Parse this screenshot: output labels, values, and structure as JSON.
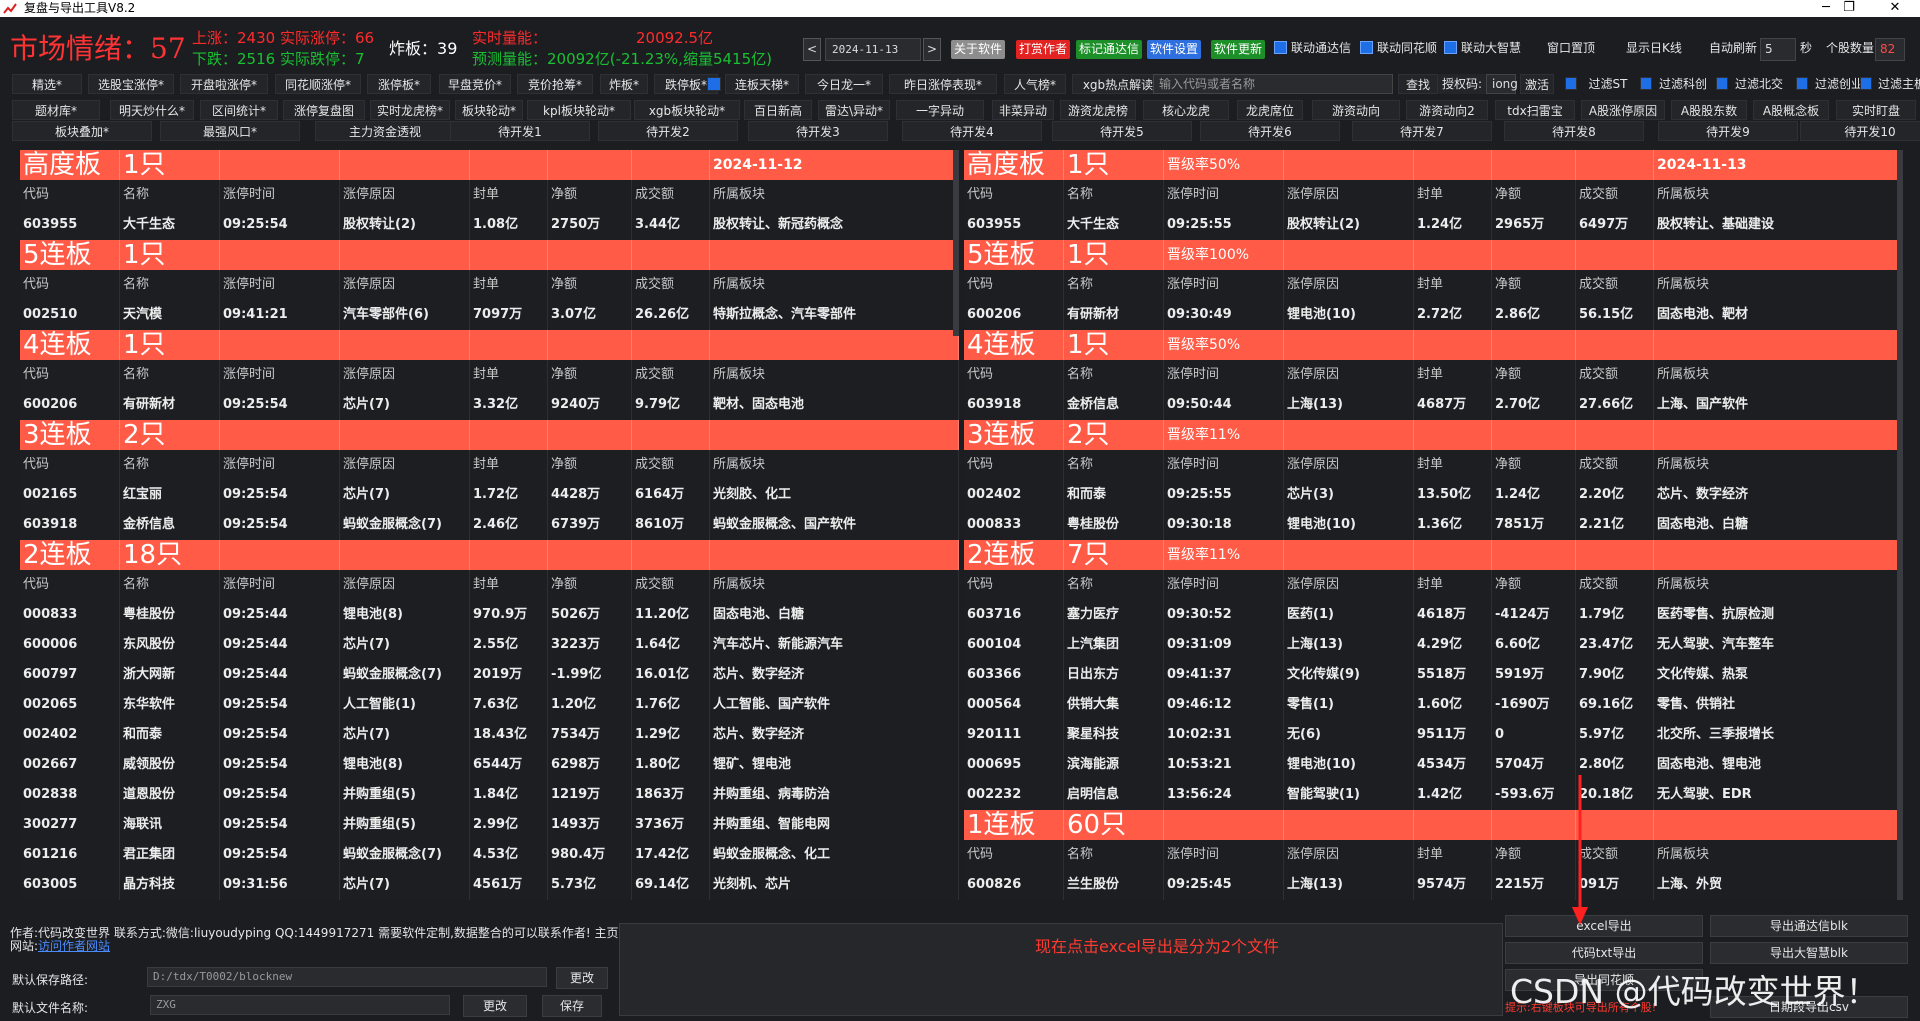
{
  "window": {
    "title": "复盘与导出工具V8.2",
    "min": "─",
    "max": "❐",
    "close": "✕"
  },
  "stats": {
    "mood_label": "市场情绪：",
    "mood_value": "57",
    "up": "上涨：2430 实际涨停：66",
    "down": "下跌：2516 实际跌停：7",
    "bomb_label": "炸板：",
    "bomb_value": "39",
    "realtime": "实时量能：",
    "realtime_value": "20092.5亿",
    "predict": "预测量能：20092亿(-21.23%,缩量5415亿)"
  },
  "controls": {
    "prev": "<",
    "date": "2024-11-13",
    "next": ">",
    "about": "关于软件",
    "tip": "打赏作者",
    "notes": "标记通达信",
    "settings": "软件设置",
    "update": "软件更新",
    "link_tdx": "联动通达信",
    "link_ths": "联动同花顺",
    "link_dzh": "联动大智慧",
    "pin": "窗口置顶",
    "show_k": "显示日K线",
    "auto_refresh": "自动刷新",
    "refresh_value": "5",
    "sec": "秒",
    "count_label": "个股数量",
    "count_value": "82"
  },
  "tabs_row1": [
    "精选*",
    "选股宝涨停*",
    "开盘啦涨停*",
    "同花顺涨停*",
    "涨停板*",
    "早盘竞价*",
    "竞价抢筹*",
    "炸板*",
    "跌停板*",
    "连板天梯*",
    "今日龙一*",
    "昨日涨停表现*",
    "人气榜*",
    "xgb热点解读*"
  ],
  "search": {
    "placeholder": "输入代码或者名称",
    "button": "查找",
    "auth_label": "授权码:",
    "auth_value": "iong",
    "activate": "激活"
  },
  "filters": [
    "过滤ST",
    "过滤科创",
    "过滤北交",
    "过滤创业",
    "过滤主板"
  ],
  "tabs_row2": [
    "题材库*",
    "明天炒什么*",
    "区间统计*",
    "涨停复盘图",
    "实时龙虎榜*",
    "板块轮动*",
    "kpl板块轮动*",
    "xgb板块轮动*",
    "百日新高",
    "雷达\\异动*",
    "一字异动",
    "非菜异动",
    "游资龙虎榜",
    "核心龙虎",
    "龙虎席位",
    "游资动向",
    "游资动向2",
    "tdx扫雷宝",
    "A股涨停原因",
    "A股股东数",
    "A股概念板",
    "实时盯盘"
  ],
  "tabs_row3": [
    "板块叠加*",
    "最强风口*",
    "主力资金透视",
    "待开发1",
    "待开发2",
    "待开发3",
    "待开发4",
    "待开发5",
    "待开发6",
    "待开发7",
    "待开发8",
    "待开发9",
    "待开发10"
  ],
  "columns": [
    "代码",
    "名称",
    "涨停时间",
    "涨停原因",
    "封单",
    "净额",
    "成交额",
    "所属板块"
  ],
  "left": {
    "groups": [
      {
        "level": "高度板",
        "count": "1只",
        "rate": "",
        "date": "2024-11-12",
        "rows": [
          [
            "603955",
            "大千生态",
            "09:25:54",
            "股权转让(2)",
            "1.08亿",
            "2750万",
            "3.44亿",
            "股权转让、新冠药概念"
          ]
        ]
      },
      {
        "level": "5连板",
        "count": "1只",
        "rate": "",
        "date": "",
        "rows": [
          [
            "002510",
            "天汽模",
            "09:41:21",
            "汽车零部件(6)",
            "7097万",
            "3.07亿",
            "26.26亿",
            "特斯拉概念、汽车零部件"
          ]
        ]
      },
      {
        "level": "4连板",
        "count": "1只",
        "rate": "",
        "date": "",
        "rows": [
          [
            "600206",
            "有研新材",
            "09:25:54",
            "芯片(7)",
            "3.32亿",
            "9240万",
            "9.79亿",
            "靶材、固态电池"
          ]
        ]
      },
      {
        "level": "3连板",
        "count": "2只",
        "rate": "",
        "date": "",
        "rows": [
          [
            "002165",
            "红宝丽",
            "09:25:54",
            "芯片(7)",
            "1.72亿",
            "4428万",
            "6164万",
            "光刻胶、化工"
          ],
          [
            "603918",
            "金桥信息",
            "09:25:54",
            "蚂蚁金服概念(7)",
            "2.46亿",
            "6739万",
            "8610万",
            "蚂蚁金服概念、国产软件"
          ]
        ]
      },
      {
        "level": "2连板",
        "count": "18只",
        "rate": "",
        "date": "",
        "rows": [
          [
            "000833",
            "粤桂股份",
            "09:25:44",
            "锂电池(8)",
            "970.9万",
            "5026万",
            "11.20亿",
            "固态电池、白糖"
          ],
          [
            "600006",
            "东风股份",
            "09:25:44",
            "芯片(7)",
            "2.55亿",
            "3223万",
            "1.64亿",
            "汽车芯片、新能源汽车"
          ],
          [
            "600797",
            "浙大网新",
            "09:25:44",
            "蚂蚁金服概念(7)",
            "2019万",
            "-1.99亿",
            "16.01亿",
            "芯片、数字经济"
          ],
          [
            "002065",
            "东华软件",
            "09:25:54",
            "人工智能(1)",
            "7.63亿",
            "1.20亿",
            "1.76亿",
            "人工智能、国产软件"
          ],
          [
            "002402",
            "和而泰",
            "09:25:54",
            "芯片(7)",
            "18.43亿",
            "7534万",
            "1.29亿",
            "芯片、数字经济"
          ],
          [
            "002667",
            "威领股份",
            "09:25:54",
            "锂电池(8)",
            "6544万",
            "6298万",
            "1.80亿",
            "锂矿、锂电池"
          ],
          [
            "002838",
            "道恩股份",
            "09:25:54",
            "并购重组(5)",
            "1.84亿",
            "1219万",
            "1863万",
            "并购重组、病毒防治"
          ],
          [
            "300277",
            "海联讯",
            "09:25:54",
            "并购重组(5)",
            "2.99亿",
            "1493万",
            "3736万",
            "并购重组、智能电网"
          ],
          [
            "601216",
            "君正集团",
            "09:25:54",
            "蚂蚁金服概念(7)",
            "4.53亿",
            "980.4万",
            "17.42亿",
            "蚂蚁金服概念、化工"
          ],
          [
            "603005",
            "晶方科技",
            "09:31:56",
            "芯片(7)",
            "4561万",
            "5.73亿",
            "69.14亿",
            "光刻机、芯片"
          ]
        ]
      }
    ]
  },
  "right": {
    "groups": [
      {
        "level": "高度板",
        "count": "1只",
        "rate": "晋级率50%",
        "date": "2024-11-13",
        "rows": [
          [
            "603955",
            "大千生态",
            "09:25:55",
            "股权转让(2)",
            "1.24亿",
            "2965万",
            "6497万",
            "股权转让、基础建设"
          ]
        ]
      },
      {
        "level": "5连板",
        "count": "1只",
        "rate": "晋级率100%",
        "date": "",
        "rows": [
          [
            "600206",
            "有研新材",
            "09:30:49",
            "锂电池(10)",
            "2.72亿",
            "2.86亿",
            "56.15亿",
            "固态电池、靶材"
          ]
        ]
      },
      {
        "level": "4连板",
        "count": "1只",
        "rate": "晋级率50%",
        "date": "",
        "rows": [
          [
            "603918",
            "金桥信息",
            "09:50:44",
            "上海(13)",
            "4687万",
            "2.70亿",
            "27.66亿",
            "上海、国产软件"
          ]
        ]
      },
      {
        "level": "3连板",
        "count": "2只",
        "rate": "晋级率11%",
        "date": "",
        "rows": [
          [
            "002402",
            "和而泰",
            "09:25:55",
            "芯片(3)",
            "13.50亿",
            "1.24亿",
            "2.20亿",
            "芯片、数字经济"
          ],
          [
            "000833",
            "粤桂股份",
            "09:30:18",
            "锂电池(10)",
            "1.36亿",
            "7851万",
            "2.21亿",
            "固态电池、白糖"
          ]
        ]
      },
      {
        "level": "2连板",
        "count": "7只",
        "rate": "晋级率11%",
        "date": "",
        "rows": [
          [
            "603716",
            "塞力医疗",
            "09:30:52",
            "医药(1)",
            "4618万",
            "-4124万",
            "1.79亿",
            "医药零售、抗原检测"
          ],
          [
            "600104",
            "上汽集团",
            "09:31:09",
            "上海(13)",
            "4.29亿",
            "6.60亿",
            "23.47亿",
            "无人驾驶、汽车整车"
          ],
          [
            "603366",
            "日出东方",
            "09:41:37",
            "文化传媒(9)",
            "5518万",
            "5919万",
            "7.90亿",
            "文化传媒、热泵"
          ],
          [
            "000564",
            "供销大集",
            "09:46:12",
            "零售(1)",
            "1.60亿",
            "-1690万",
            "69.16亿",
            "零售、供销社"
          ],
          [
            "920111",
            "聚星科技",
            "10:02:31",
            "无(6)",
            "9511万",
            "0",
            "5.97亿",
            "北交所、三季报增长"
          ],
          [
            "000695",
            "滨海能源",
            "10:53:21",
            "锂电池(10)",
            "4534万",
            "5704万",
            "2.80亿",
            "固态电池、锂电池"
          ],
          [
            "002232",
            "启明信息",
            "13:56:24",
            "智能驾驶(1)",
            "1.42亿",
            "-593.6万",
            "20.18亿",
            "无人驾驶、EDR"
          ]
        ]
      },
      {
        "level": "1连板",
        "count": "60只",
        "rate": "",
        "date": "",
        "rows": [
          [
            "600826",
            "兰生股份",
            "09:25:45",
            "上海(13)",
            "9574万",
            "2215万",
            "091万",
            "上海、外贸"
          ]
        ]
      }
    ]
  },
  "footer": {
    "author": "作者:代码改变世界 联系方式:微信:liuyoudyping QQ:1449917271 需要软件定制,数据整合的可以联系作者! 主页",
    "site_label": "网站:",
    "site_link": "访问作者网站",
    "save_path_label": "默认保存路径:",
    "save_path": "D:/tdx/T0002/blocknew",
    "change1": "更改",
    "file_label": "默认文件名称:",
    "file_value": "ZXG",
    "change2": "更改",
    "save": "保存",
    "log_note": "现在点击excel导出是分为2个文件",
    "btn_excel": "excel导出",
    "btn_tdx": "导出通达信blk",
    "btn_txt": "代码txt导出",
    "btn_dzh": "导出大智慧blk",
    "btn_c": "导出同花顺",
    "btn_csv": "日期段导出csv",
    "hint": "提示:右键板块可导出所有个股!",
    "watermark": "CSDN @代码改变世界！"
  },
  "colors": {
    "accent": "#ff5b47",
    "up": "#ff2b2b",
    "down": "#19c032"
  }
}
